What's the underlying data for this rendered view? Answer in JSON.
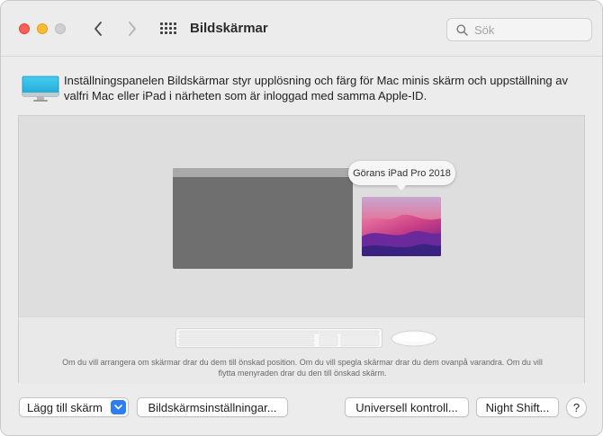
{
  "window": {
    "title": "Bildskärmar",
    "search": {
      "placeholder": "Sök",
      "value": ""
    }
  },
  "icons": {
    "close": "close-button",
    "minimize": "minimize-button",
    "zoom": "zoom-button",
    "back": "chevron-left-icon",
    "forward": "chevron-right-icon",
    "show_all": "grid-icon",
    "search": "magnifier-icon",
    "info": "display-icon",
    "add_dropdown": "chevron-down-icon",
    "help": "question-mark-icon"
  },
  "info": {
    "text": "Inställningspanelen Bildskärmar styr upplösning och färg för Mac minis skärm och uppställning av valfri Mac eller iPad i närheten som är inloggad med samma Apple-ID."
  },
  "arrangement": {
    "ipad_tooltip": "Görans iPad Pro 2018",
    "hint": "Om du vill arrangera om skärmar drar du dem till önskad position. Om du vill spegla skärmar drar du dem ovanpå varandra. Om du vill flytta menyraden drar du den till önskad skärm."
  },
  "buttons": {
    "add_display": "Lägg till skärm",
    "display_settings": "Bildskärmsinställningar...",
    "universal_control": "Universell kontroll...",
    "night_shift": "Night Shift...",
    "help": "?"
  },
  "colors": {
    "close": "#fe5f57",
    "minimize": "#febc2e",
    "accent": "#2e7cf6",
    "display_gray": "#6f6f6f",
    "info_icon": "#1fb6e0"
  }
}
